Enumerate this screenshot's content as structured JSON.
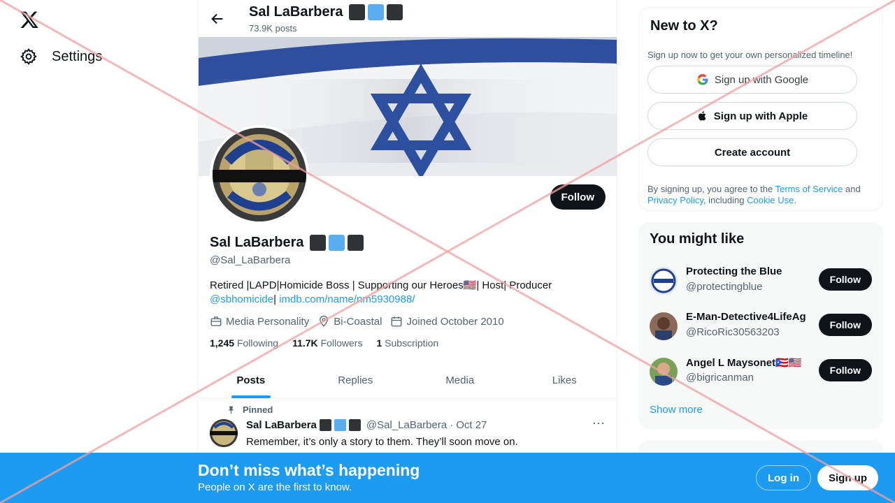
{
  "nav": {
    "settings_label": "Settings"
  },
  "header": {
    "name": "Sal LaBarbera",
    "posts": "73.9K posts"
  },
  "profile": {
    "follow_label": "Follow",
    "name": "Sal LaBarbera",
    "handle": "@Sal_LaBarbera",
    "bio_text": "Retired |LAPD|Homicide Boss | Supporting our Heroes🇺🇸| Host| Producer",
    "bio_link1": "@sbhomicide",
    "bio_sep": "| ",
    "bio_link2": "imdb.com/name/nm5930988/",
    "category": "Media Personality",
    "location": "Bi-Coastal",
    "joined": "Joined October 2010",
    "following_count": "1,245",
    "following_label": "Following",
    "followers_count": "11.7K",
    "followers_label": "Followers",
    "subscription_count": "1",
    "subscription_label": "Subscription"
  },
  "tabs": [
    {
      "label": "Posts"
    },
    {
      "label": "Replies"
    },
    {
      "label": "Media"
    },
    {
      "label": "Likes"
    }
  ],
  "tweet": {
    "pinned_label": "Pinned",
    "name": "Sal LaBarbera",
    "handle": "@Sal_LaBarbera",
    "dot": "·",
    "date": "Oct 27",
    "text": "Remember, it’s only a story to them. They’ll soon move on."
  },
  "signup_card": {
    "title": "New to X?",
    "subtitle": "Sign up now to get your own personalized timeline!",
    "google_label": "Sign up with Google",
    "apple_label": "Sign up with Apple",
    "create_label": "Create account",
    "terms_prefix": "By signing up, you agree to the ",
    "terms_link": "Terms of Service",
    "terms_and": " and ",
    "privacy_link": "Privacy Policy",
    "terms_including": ", including ",
    "cookie_link": "Cookie Use",
    "terms_end": "."
  },
  "suggestions": {
    "title": "You might like",
    "people": [
      {
        "name": "Protecting the Blue",
        "handle": "@protectingblue",
        "follow": "Follow"
      },
      {
        "name": "E-Man-Detective4LifeAg",
        "handle": "@RicoRic30563203",
        "follow": "Follow"
      },
      {
        "name": "Angel L Maysonet🇵🇷🇺🇸",
        "handle": "@bigricanman",
        "follow": "Follow"
      }
    ],
    "show_more": "Show more"
  },
  "bottom_bar": {
    "title": "Don’t miss what’s happening",
    "subtitle": "People on X are the first to know.",
    "login_label": "Log in",
    "signup_label": "Sign up"
  },
  "colors": {
    "accent": "#1d9bf0",
    "primary_text": "#0f1419",
    "secondary_text": "#536471",
    "overlay_x": "#f0a0a0"
  }
}
